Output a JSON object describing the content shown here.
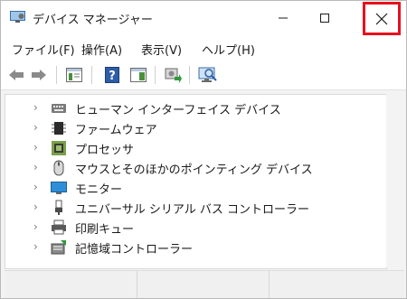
{
  "window": {
    "title": "デバイス マネージャー",
    "close_highlight_color": "#e8101e"
  },
  "menu": [
    {
      "label": "ファイル(F)"
    },
    {
      "label": "操作(A)"
    },
    {
      "label": "表示(V)"
    },
    {
      "label": "ヘルプ(H)"
    }
  ],
  "toolbar": {
    "icons": [
      "back-arrow-icon",
      "forward-arrow-icon",
      "properties-icon",
      "help-icon",
      "action-pane-icon",
      "update-driver-icon",
      "scan-hardware-icon"
    ]
  },
  "tree": {
    "items": [
      {
        "label": "ヒューマン インターフェイス デバイス",
        "icon": "hid-keyboard-icon"
      },
      {
        "label": "ファームウェア",
        "icon": "firmware-chip-icon"
      },
      {
        "label": "プロセッサ",
        "icon": "processor-icon"
      },
      {
        "label": "マウスとそのほかのポインティング デバイス",
        "icon": "mouse-icon"
      },
      {
        "label": "モニター",
        "icon": "monitor-icon"
      },
      {
        "label": "ユニバーサル シリアル バス コントローラー",
        "icon": "usb-icon"
      },
      {
        "label": "印刷キュー",
        "icon": "printer-icon"
      },
      {
        "label": "記憶域コントローラー",
        "icon": "storage-controller-icon"
      }
    ],
    "chevron": "›"
  }
}
